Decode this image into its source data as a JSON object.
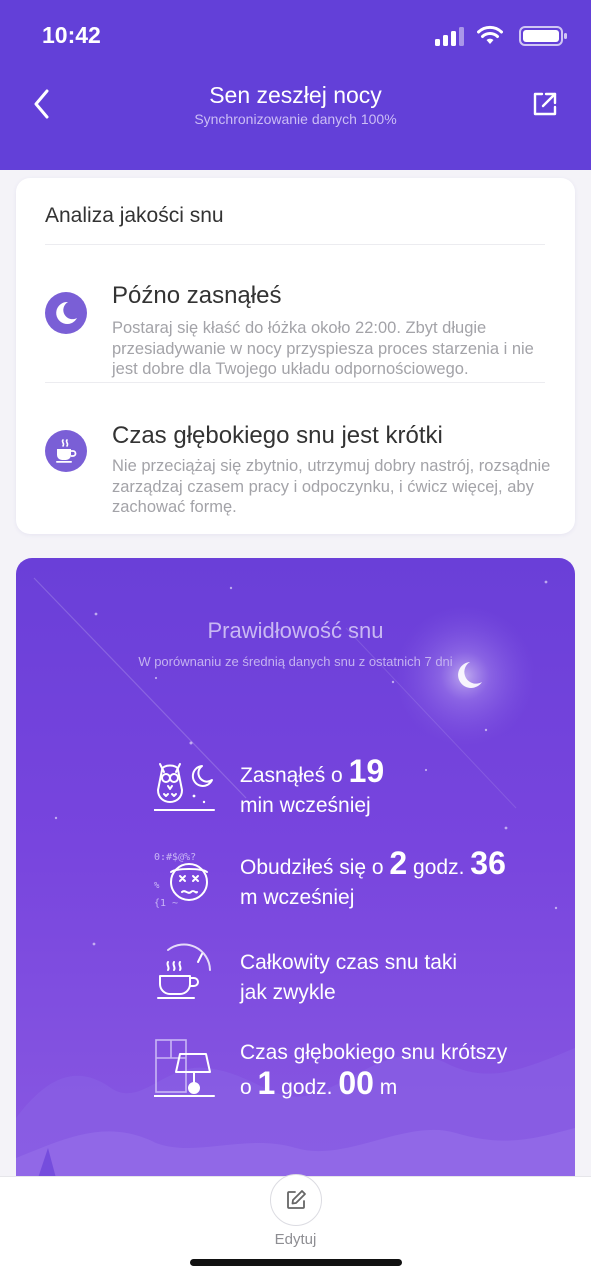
{
  "status_bar": {
    "time": "10:42"
  },
  "header": {
    "title": "Sen zeszłej nocy",
    "subtitle": "Synchronizowanie danych 100%"
  },
  "analysis": {
    "title": "Analiza jakości snu",
    "items": [
      {
        "icon": "moon-icon",
        "title": "Późno zasnąłeś",
        "body": "Postaraj się kłaść do łóżka około 22:00. Zbyt długie przesiadywanie w nocy przyspiesza proces starzenia i nie jest dobre dla Twojego układu odpornościowego."
      },
      {
        "icon": "coffee-cup-icon",
        "title": "Czas głębokiego snu jest krótki",
        "body": "Nie przeciążaj się zbytnio, utrzymuj dobry nastrój, rozsądnie zarządzaj czasem pracy i odpoczynku, i ćwicz więcej, aby zachować formę."
      }
    ]
  },
  "regularity": {
    "title": "Prawidłowość snu",
    "subtitle": "W porównaniu ze średnią danych snu z ostatnich 7 dni",
    "stats": [
      {
        "icon": "owl-icon",
        "line1_prefix": "Zasnąłeś o ",
        "line1_value": "19",
        "line2": "min wcześniej"
      },
      {
        "icon": "dizzy-face-icon",
        "line1_prefix": "Obudziłeś się o ",
        "line1_value": "2",
        "line1_mid": " godz. ",
        "line1_value2": "36",
        "line2": "m wcześniej"
      },
      {
        "icon": "cup-clock-icon",
        "line1": "Całkowity czas snu taki",
        "line2": "jak zwykle"
      },
      {
        "icon": "bed-lamp-icon",
        "line1": "Czas głębokiego snu krótszy",
        "line2_prefix": "o ",
        "line2_value": "1",
        "line2_mid": " godz. ",
        "line2_value2": "00",
        "line2_suffix": " m"
      }
    ]
  },
  "bottom": {
    "edit_label": "Edytuj"
  },
  "colors": {
    "header_bg": "#6340d8",
    "accent": "#7a5fd6",
    "card_bg": "#ffffff"
  }
}
